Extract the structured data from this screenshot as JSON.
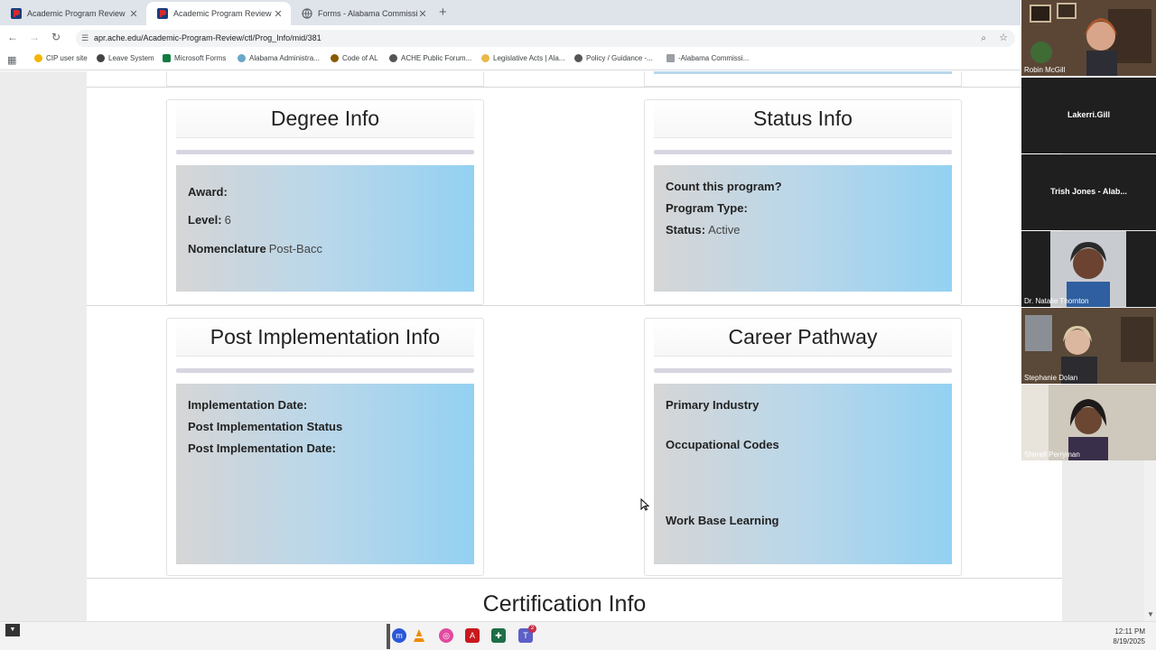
{
  "browser": {
    "tabs": [
      {
        "title": "Academic Program Review",
        "active": false
      },
      {
        "title": "Academic Program Review",
        "active": true
      },
      {
        "title": "Forms - Alabama Commission o",
        "active": false
      }
    ],
    "url": "apr.ache.edu/Academic-Program-Review/ctl/Prog_Info/mid/381",
    "bookmarks": [
      "CIP user site",
      "Leave System",
      "Microsoft Forms",
      "Alabama Administra...",
      "Code of AL",
      "ACHE Public Forum...",
      "Legislative Acts | Ala...",
      "Policy / Guidance -...",
      "-Alabama Commissi..."
    ]
  },
  "degree_info": {
    "title": "Degree Info",
    "award_label": "Award:",
    "award_value": "",
    "level_label": "Level:",
    "level_value": "6",
    "nomenclature_label": "Nomenclature",
    "nomenclature_value": "Post-Bacc"
  },
  "status_info": {
    "title": "Status Info",
    "count_label": "Count this program?",
    "program_type_label": "Program Type:",
    "status_label": "Status:",
    "status_value": "Active"
  },
  "post_implementation": {
    "title": "Post Implementation Info",
    "implementation_date_label": "Implementation Date:",
    "post_status_label": "Post Implementation Status",
    "post_date_label": "Post Implementation Date:"
  },
  "career_pathway": {
    "title": "Career Pathway",
    "primary_industry_label": "Primary Industry",
    "occupational_codes_label": "Occupational Codes",
    "work_base_label": "Work Base Learning"
  },
  "certification": {
    "title": "Certification Info"
  },
  "participants": [
    {
      "name": "Robin McGill",
      "video": true
    },
    {
      "name": "Lakerri.Gill",
      "video": false
    },
    {
      "name": "Trish Jones - Alab...",
      "video": false
    },
    {
      "name": "Dr. Natalie Thornton",
      "video": true
    },
    {
      "name": "Stephanie Dolan",
      "video": true
    },
    {
      "name": "Shirrell Perryman",
      "video": true
    }
  ],
  "taskbar": {
    "time": "12:11 PM",
    "date": "8/19/2025",
    "teams_badge": "2"
  }
}
